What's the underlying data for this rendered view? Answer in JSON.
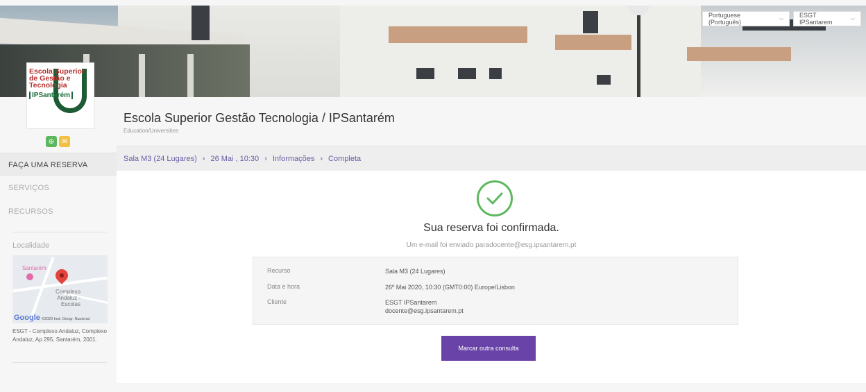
{
  "header": {
    "language_label": "Portuguese (Português)",
    "account_label": "ESGT IPSantarem"
  },
  "logo": {
    "line1": "Escola Superior",
    "line2": "de Gestão e",
    "line3": "Tecnologia",
    "line4": "IPSantarém"
  },
  "business": {
    "title": "Escola Superior Gestão Tecnologia / IPSantarém",
    "category": "Education/Universities"
  },
  "breadcrumb": {
    "items": [
      "Sala M3 (24 Lugares)",
      "26 Mai , 10:30",
      "Informações",
      "Completa"
    ],
    "separator": "›"
  },
  "sidebar": {
    "items": [
      {
        "label": "FAÇA UMA RESERVA",
        "active": true
      },
      {
        "label": "SERVIÇOS",
        "active": false
      },
      {
        "label": "RECURSOS",
        "active": false
      }
    ],
    "location_title": "Localidade",
    "map": {
      "label_city": "Santarém",
      "label_place": "Complexo Andaluz - Escolas",
      "google": "Google",
      "copyright": "©2020 Inst. Geogr. Nacional"
    },
    "address": "ESGT - Complexo Andaluz, Complexo Andaluz, Ap 295, Santarém, 2001."
  },
  "confirmation": {
    "title": "Sua reserva foi confirmada.",
    "subtitle": "Um e-mail foi enviado paradocente@esg.ipsantarem.pt",
    "details": [
      {
        "label": "Recurso",
        "value": "Sala M3 (24 Lugares)",
        "value2": ""
      },
      {
        "label": "Data e hora",
        "value": "26º Mai 2020, 10:30 (GMT0:00) Europe/Lisbon",
        "value2": ""
      },
      {
        "label": "Cliente",
        "value": "ESGT IPSantarem",
        "value2": "docente@esg.ipsantarem.pt"
      }
    ],
    "button_label": "Marcar outra consulta"
  },
  "colors": {
    "accent": "#6a43a8",
    "success": "#5cb85c",
    "link": "#6a5aa6"
  }
}
